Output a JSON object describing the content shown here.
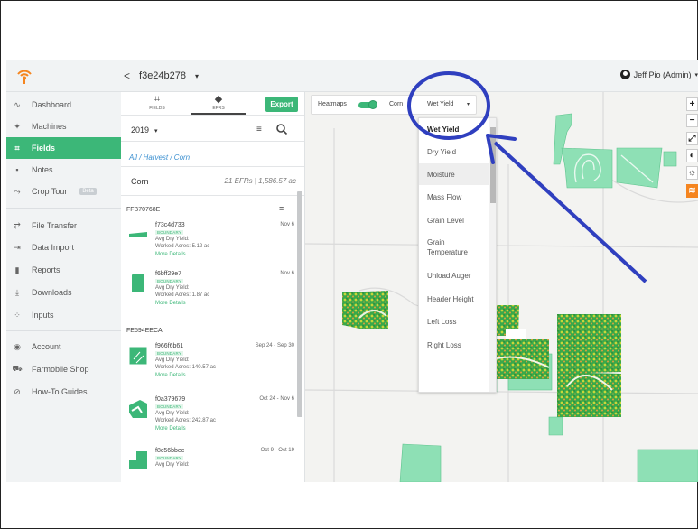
{
  "header": {
    "back_arrow": "<",
    "field_id": "f3e24b278",
    "caret": "▾",
    "user": "Jeff Pio (Admin)",
    "user_caret": "▾"
  },
  "sidebar": {
    "items": [
      {
        "icon": "∿",
        "label": "Dashboard"
      },
      {
        "icon": "✦",
        "label": "Machines"
      },
      {
        "icon": "⌗",
        "label": "Fields"
      },
      {
        "icon": "▪",
        "label": "Notes"
      },
      {
        "icon": "⤳",
        "label": "Crop Tour",
        "badge": "Beta"
      },
      {
        "icon": "⇄",
        "label": "File Transfer"
      },
      {
        "icon": "⇥",
        "label": "Data Import"
      },
      {
        "icon": "▮",
        "label": "Reports"
      },
      {
        "icon": "⤓",
        "label": "Downloads"
      },
      {
        "icon": "⁘",
        "label": "Inputs"
      },
      {
        "icon": "◉",
        "label": "Account"
      },
      {
        "icon": "⛟",
        "label": "Farmobile Shop"
      },
      {
        "icon": "⊘",
        "label": "How-To Guides"
      }
    ]
  },
  "panel": {
    "tabs": [
      {
        "label": "FIELDS",
        "icon": "⌗"
      },
      {
        "label": "EFRS",
        "icon": "◆"
      }
    ],
    "export_label": "Export",
    "year": "2019",
    "year_caret": "▾",
    "filter_icon": "≡",
    "breadcrumb": "All / Harvest / Corn",
    "crop": "Corn",
    "crop_summary": "21 EFRs | 1,586.57 ac",
    "groups": [
      "FFB70768E",
      "FE594EECA"
    ],
    "sort_icon": "≡",
    "entries": [
      {
        "name": "f73c4d733",
        "date": "Nov 6",
        "badge": "BOUNDARY",
        "yield": "Avg Dry Yield:",
        "acres": "Worked Acres: 5.12 ac",
        "more": "More Details"
      },
      {
        "name": "f6bff29e7",
        "date": "Nov 6",
        "badge": "BOUNDARY",
        "yield": "Avg Dry Yield:",
        "acres": "Worked Acres: 1.87 ac",
        "more": "More Details"
      },
      {
        "name": "f966f6b61",
        "date": "Sep 24 - Sep 30",
        "badge": "BOUNDARY",
        "yield": "Avg Dry Yield:",
        "acres": "Worked Acres: 140.57 ac",
        "more": "More Details"
      },
      {
        "name": "f0a379679",
        "date": "Oct 24 - Nov 6",
        "badge": "BOUNDARY",
        "yield": "Avg Dry Yield:",
        "acres": "Worked Acres: 242.87 ac",
        "more": "More Details"
      },
      {
        "name": "f8c56bbec",
        "date": "Oct 9 - Oct 19",
        "badge": "BOUNDARY",
        "yield": "Avg Dry Yield:",
        "acres": "",
        "more": ""
      }
    ]
  },
  "map": {
    "heatmaps_label": "Heatmaps",
    "crop_label": "Corn",
    "metric_label": "Wet Yield",
    "metric_caret": "▾",
    "dropdown": [
      "Wet Yield",
      "Dry Yield",
      "Moisture",
      "Mass Flow",
      "Grain Level",
      "Grain Temperature",
      "Unload Auger",
      "Header Height",
      "Left Loss",
      "Right Loss"
    ],
    "controls": [
      "+",
      "−",
      "⤢",
      "◐",
      "☼",
      "≋"
    ]
  },
  "colors": {
    "accent": "#3cb778",
    "annotation": "#2f3fbf",
    "field_fill": "#8ee0b5",
    "orange": "#f5851f"
  }
}
